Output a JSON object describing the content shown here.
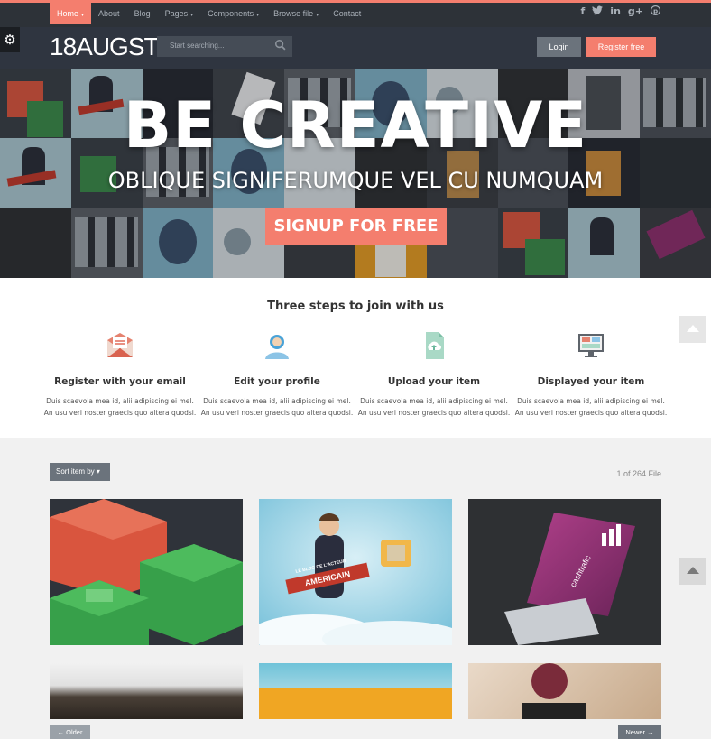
{
  "nav": {
    "items": [
      {
        "label": "Home",
        "caret": "▾",
        "active": true
      },
      {
        "label": "About",
        "caret": "",
        "active": false
      },
      {
        "label": "Blog",
        "caret": "",
        "active": false
      },
      {
        "label": "Pages",
        "caret": "▾",
        "active": false
      },
      {
        "label": "Components",
        "caret": "▾",
        "active": false
      },
      {
        "label": "Browse file",
        "caret": "▾",
        "active": false
      },
      {
        "label": "Contact",
        "caret": "",
        "active": false
      }
    ],
    "social": [
      "facebook-icon",
      "twitter-icon",
      "linkedin-icon",
      "google-plus-icon",
      "pinterest-icon"
    ]
  },
  "header": {
    "logo": "18AUGST",
    "search_placeholder": "Start searching...",
    "login_label": "Login",
    "register_label": "Register free"
  },
  "hero": {
    "title": "BE CREATIVE",
    "subtitle": "OBLIQUE SIGNIFERUMQUE VEL CU NUMQUAM",
    "cta": "SIGNUP FOR FREE"
  },
  "steps": {
    "heading": "Three steps to join with us",
    "items": [
      {
        "title": "Register with your email",
        "line1": "Duis scaevola mea id, alii adipiscing ei mel.",
        "line2": "An usu veri noster graecis quo altera quodsi.",
        "icon": "envelope-icon"
      },
      {
        "title": "Edit your profile",
        "line1": "Duis scaevola mea id, alii adipiscing ei mel.",
        "line2": "An usu veri noster graecis quo altera quodsi.",
        "icon": "user-icon"
      },
      {
        "title": "Upload your item",
        "line1": "Duis scaevola mea id, alii adipiscing ei mel.",
        "line2": "An usu veri noster graecis quo altera quodsi.",
        "icon": "upload-file-icon"
      },
      {
        "title": "Displayed your item",
        "line1": "Duis scaevola mea id, alii adipiscing ei mel.",
        "line2": "An usu veri noster graecis quo altera quodsi.",
        "icon": "monitor-icon"
      }
    ]
  },
  "gallery": {
    "sort_label": "Sort item by ▾",
    "count_label": "1 of 264 File",
    "older_label": "← Older",
    "newer_label": "Newer →",
    "card_texts": {
      "banner_top": "LE BLOG DE L'ACTEUR",
      "banner_main": "AMERICAIN",
      "business_card": "cashtrafic"
    }
  },
  "colors": {
    "accent": "#f47e6e",
    "nav_bg": "#2d3238",
    "header_bg": "#2f3540",
    "button_gray": "#6b737c"
  }
}
